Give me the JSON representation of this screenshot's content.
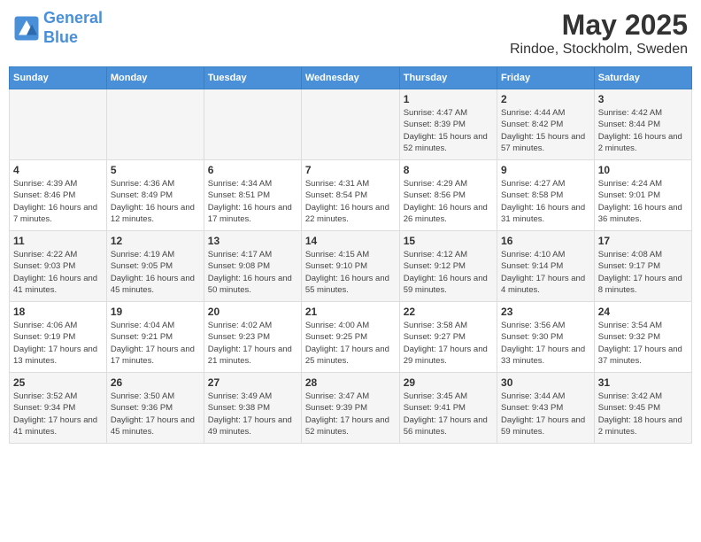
{
  "app": {
    "logo_line1": "General",
    "logo_line2": "Blue"
  },
  "title": "May 2025",
  "subtitle": "Rindoe, Stockholm, Sweden",
  "days_of_week": [
    "Sunday",
    "Monday",
    "Tuesday",
    "Wednesday",
    "Thursday",
    "Friday",
    "Saturday"
  ],
  "weeks": [
    [
      {
        "num": "",
        "detail": ""
      },
      {
        "num": "",
        "detail": ""
      },
      {
        "num": "",
        "detail": ""
      },
      {
        "num": "",
        "detail": ""
      },
      {
        "num": "1",
        "detail": "Sunrise: 4:47 AM\nSunset: 8:39 PM\nDaylight: 15 hours and 52 minutes."
      },
      {
        "num": "2",
        "detail": "Sunrise: 4:44 AM\nSunset: 8:42 PM\nDaylight: 15 hours and 57 minutes."
      },
      {
        "num": "3",
        "detail": "Sunrise: 4:42 AM\nSunset: 8:44 PM\nDaylight: 16 hours and 2 minutes."
      }
    ],
    [
      {
        "num": "4",
        "detail": "Sunrise: 4:39 AM\nSunset: 8:46 PM\nDaylight: 16 hours and 7 minutes."
      },
      {
        "num": "5",
        "detail": "Sunrise: 4:36 AM\nSunset: 8:49 PM\nDaylight: 16 hours and 12 minutes."
      },
      {
        "num": "6",
        "detail": "Sunrise: 4:34 AM\nSunset: 8:51 PM\nDaylight: 16 hours and 17 minutes."
      },
      {
        "num": "7",
        "detail": "Sunrise: 4:31 AM\nSunset: 8:54 PM\nDaylight: 16 hours and 22 minutes."
      },
      {
        "num": "8",
        "detail": "Sunrise: 4:29 AM\nSunset: 8:56 PM\nDaylight: 16 hours and 26 minutes."
      },
      {
        "num": "9",
        "detail": "Sunrise: 4:27 AM\nSunset: 8:58 PM\nDaylight: 16 hours and 31 minutes."
      },
      {
        "num": "10",
        "detail": "Sunrise: 4:24 AM\nSunset: 9:01 PM\nDaylight: 16 hours and 36 minutes."
      }
    ],
    [
      {
        "num": "11",
        "detail": "Sunrise: 4:22 AM\nSunset: 9:03 PM\nDaylight: 16 hours and 41 minutes."
      },
      {
        "num": "12",
        "detail": "Sunrise: 4:19 AM\nSunset: 9:05 PM\nDaylight: 16 hours and 45 minutes."
      },
      {
        "num": "13",
        "detail": "Sunrise: 4:17 AM\nSunset: 9:08 PM\nDaylight: 16 hours and 50 minutes."
      },
      {
        "num": "14",
        "detail": "Sunrise: 4:15 AM\nSunset: 9:10 PM\nDaylight: 16 hours and 55 minutes."
      },
      {
        "num": "15",
        "detail": "Sunrise: 4:12 AM\nSunset: 9:12 PM\nDaylight: 16 hours and 59 minutes."
      },
      {
        "num": "16",
        "detail": "Sunrise: 4:10 AM\nSunset: 9:14 PM\nDaylight: 17 hours and 4 minutes."
      },
      {
        "num": "17",
        "detail": "Sunrise: 4:08 AM\nSunset: 9:17 PM\nDaylight: 17 hours and 8 minutes."
      }
    ],
    [
      {
        "num": "18",
        "detail": "Sunrise: 4:06 AM\nSunset: 9:19 PM\nDaylight: 17 hours and 13 minutes."
      },
      {
        "num": "19",
        "detail": "Sunrise: 4:04 AM\nSunset: 9:21 PM\nDaylight: 17 hours and 17 minutes."
      },
      {
        "num": "20",
        "detail": "Sunrise: 4:02 AM\nSunset: 9:23 PM\nDaylight: 17 hours and 21 minutes."
      },
      {
        "num": "21",
        "detail": "Sunrise: 4:00 AM\nSunset: 9:25 PM\nDaylight: 17 hours and 25 minutes."
      },
      {
        "num": "22",
        "detail": "Sunrise: 3:58 AM\nSunset: 9:27 PM\nDaylight: 17 hours and 29 minutes."
      },
      {
        "num": "23",
        "detail": "Sunrise: 3:56 AM\nSunset: 9:30 PM\nDaylight: 17 hours and 33 minutes."
      },
      {
        "num": "24",
        "detail": "Sunrise: 3:54 AM\nSunset: 9:32 PM\nDaylight: 17 hours and 37 minutes."
      }
    ],
    [
      {
        "num": "25",
        "detail": "Sunrise: 3:52 AM\nSunset: 9:34 PM\nDaylight: 17 hours and 41 minutes."
      },
      {
        "num": "26",
        "detail": "Sunrise: 3:50 AM\nSunset: 9:36 PM\nDaylight: 17 hours and 45 minutes."
      },
      {
        "num": "27",
        "detail": "Sunrise: 3:49 AM\nSunset: 9:38 PM\nDaylight: 17 hours and 49 minutes."
      },
      {
        "num": "28",
        "detail": "Sunrise: 3:47 AM\nSunset: 9:39 PM\nDaylight: 17 hours and 52 minutes."
      },
      {
        "num": "29",
        "detail": "Sunrise: 3:45 AM\nSunset: 9:41 PM\nDaylight: 17 hours and 56 minutes."
      },
      {
        "num": "30",
        "detail": "Sunrise: 3:44 AM\nSunset: 9:43 PM\nDaylight: 17 hours and 59 minutes."
      },
      {
        "num": "31",
        "detail": "Sunrise: 3:42 AM\nSunset: 9:45 PM\nDaylight: 18 hours and 2 minutes."
      }
    ]
  ]
}
